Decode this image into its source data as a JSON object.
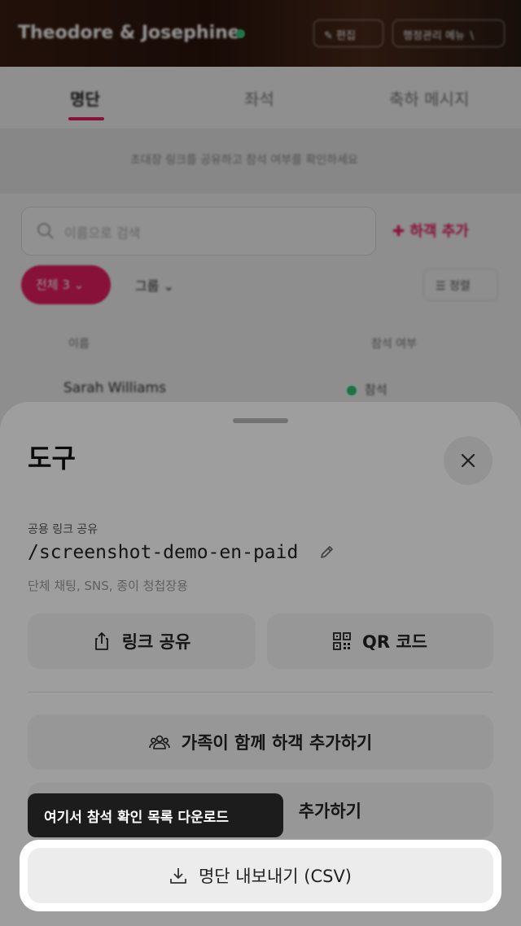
{
  "background": {
    "hero": {
      "title": "Theodore & Josephine",
      "edit_label": "✎ 편집",
      "menu_label": "행정관리 메뉴 ∖"
    },
    "tabs": [
      {
        "label": "명단"
      },
      {
        "label": "좌석"
      },
      {
        "label": "축하 메시지"
      }
    ],
    "notice": "초대장 링크를 공유하고 참석 여부를 확인하세요",
    "search_placeholder": "이름으로 검색",
    "add_guest_label": "하객 추가",
    "filter_all": "전체 3 ⌄",
    "filter_group": "그룹 ⌄",
    "sort_label": "정렬",
    "columns": [
      "이름",
      "참석 여부"
    ],
    "rows": [
      {
        "name": "Sarah Williams",
        "status": "참석"
      }
    ]
  },
  "sheet": {
    "title": "도구",
    "link_label": "공용 링크 공유",
    "link_path": "/screenshot-demo-en-paid",
    "link_hint": "단체 채팅, SNS, 종이 청첩장용",
    "share_label": "링크 공유",
    "qr_label": "QR 코드",
    "family_label": "가족이 함께 하객 추가하기",
    "add2_label": "추가하기",
    "export_label": "명단 내보내기 (CSV)"
  },
  "tooltip": "여기서 참석 확인 목록 다운로드",
  "colors": {
    "accent": "#e91e63",
    "online": "#37c77b"
  }
}
